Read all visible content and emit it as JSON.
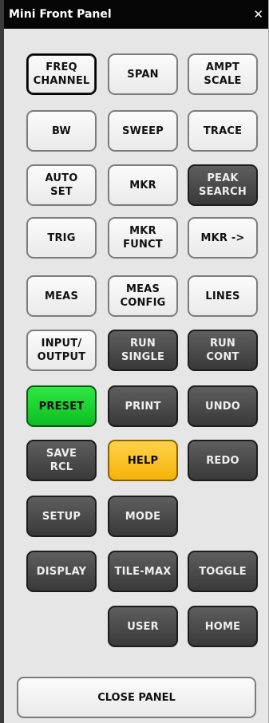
{
  "window": {
    "title": "Mini Front Panel",
    "close_glyph": "✕"
  },
  "buttons": {
    "freq_channel": "FREQ\nCHANNEL",
    "span": "SPAN",
    "ampt_scale": "AMPT\nSCALE",
    "bw": "BW",
    "sweep": "SWEEP",
    "trace": "TRACE",
    "auto_set": "AUTO\nSET",
    "mkr": "MKR",
    "peak_search": "PEAK\nSEARCH",
    "trig": "TRIG",
    "mkr_funct": "MKR\nFUNCT",
    "mkr_arrow": "MKR ->",
    "meas": "MEAS",
    "meas_config": "MEAS\nCONFIG",
    "lines": "LINES",
    "input_output": "INPUT/\nOUTPUT",
    "run_single": "RUN\nSINGLE",
    "run_cont": "RUN\nCONT",
    "preset": "PRESET",
    "print": "PRINT",
    "undo": "UNDO",
    "save_rcl": "SAVE\nRCL",
    "help": "HELP",
    "redo": "REDO",
    "setup": "SETUP",
    "mode": "MODE",
    "display": "DISPLAY",
    "tile_max": "TILE-MAX",
    "toggle": "TOGGLE",
    "user": "USER",
    "home": "HOME",
    "close_panel": "CLOSE PANEL"
  },
  "colors": {
    "preset": "#13cc2a",
    "help": "#f8b81a",
    "dark": "#3f3f3f",
    "light": "#f2f2f2"
  }
}
